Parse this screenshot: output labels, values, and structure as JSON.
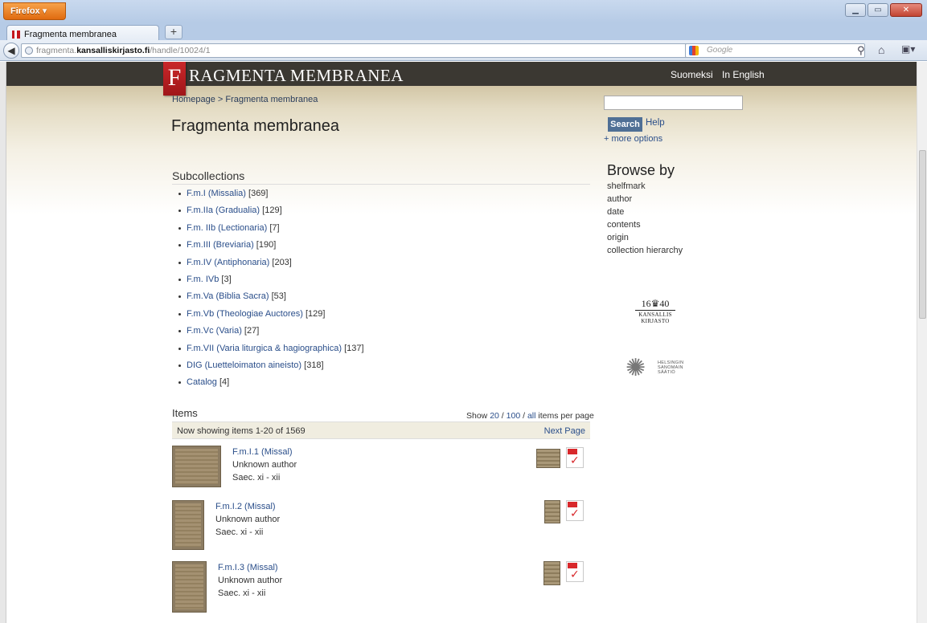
{
  "browser": {
    "menu_button": "Firefox ▾",
    "tab_title": "Fragmenta membranea",
    "new_tab": "+",
    "url_prefix": "fragmenta.",
    "url_host": "kansalliskirjasto.fi",
    "url_path": "/handle/10024/1",
    "search_placeholder": "Google",
    "url_icons": "☆ ▿ C"
  },
  "header": {
    "logo_letter": "F",
    "logo_text": "RAGMENTA MEMBRANEA",
    "lang_fi": "Suomeksi",
    "lang_en": "In English"
  },
  "breadcrumb": {
    "home": "Homepage",
    "sep": ">",
    "current": "Fragmenta membranea"
  },
  "page_title": "Fragmenta membranea",
  "search": {
    "value": "",
    "button": "Search",
    "help": "Help",
    "more_options": "+ more options"
  },
  "browse": {
    "title": "Browse by",
    "items": [
      "shelfmark",
      "author",
      "date",
      "contents",
      "origin",
      "collection hierarchy"
    ]
  },
  "subcollections": {
    "heading": "Subcollections",
    "items": [
      {
        "name": "F.m.I (Missalia)",
        "count": "[369]"
      },
      {
        "name": "F.m.IIa (Gradualia)",
        "count": "[129]"
      },
      {
        "name": "F.m. IIb (Lectionaria)",
        "count": "[7]"
      },
      {
        "name": "F.m.III (Breviaria)",
        "count": "[190]"
      },
      {
        "name": "F.m.IV (Antiphonaria)",
        "count": "[203]"
      },
      {
        "name": "F.m. IVb",
        "count": "[3]"
      },
      {
        "name": "F.m.Va (Biblia Sacra)",
        "count": "[53]"
      },
      {
        "name": "F.m.Vb (Theologiae Auctores)",
        "count": "[129]"
      },
      {
        "name": "F.m.Vc (Varia)",
        "count": "[27]"
      },
      {
        "name": "F.m.VII (Varia liturgica & hagiographica)",
        "count": "[137]"
      },
      {
        "name": "DIG (Luetteloimaton aineisto)",
        "count": "[318]"
      },
      {
        "name": "Catalog",
        "count": "[4]"
      }
    ]
  },
  "logos": {
    "kk_year_left": "16",
    "kk_year_right": "40",
    "kk_line1": "KANSALLIS",
    "kk_line2": "KIRJASTO",
    "hs_line1": "HELSINGIN",
    "hs_line2": "SANOMAIN",
    "hs_line3": "SÄÄTIÖ"
  },
  "items": {
    "heading": "Items",
    "per_page_prefix": "Show",
    "per_page_20": "20",
    "per_page_sep1": "/",
    "per_page_100": "100",
    "per_page_sep2": "/",
    "per_page_all": "all",
    "per_page_suffix": "items per page",
    "showing": "Now showing items 1-20 of 1569",
    "next": "Next Page",
    "list": [
      {
        "title": "F.m.I.1 (Missal)",
        "author": "Unknown author",
        "date": "Saec. xi - xii"
      },
      {
        "title": "F.m.I.2 (Missal)",
        "author": "Unknown author",
        "date": "Saec. xi - xii"
      },
      {
        "title": "F.m.I.3 (Missal)",
        "author": "Unknown author",
        "date": "Saec. xi - xii"
      }
    ]
  }
}
